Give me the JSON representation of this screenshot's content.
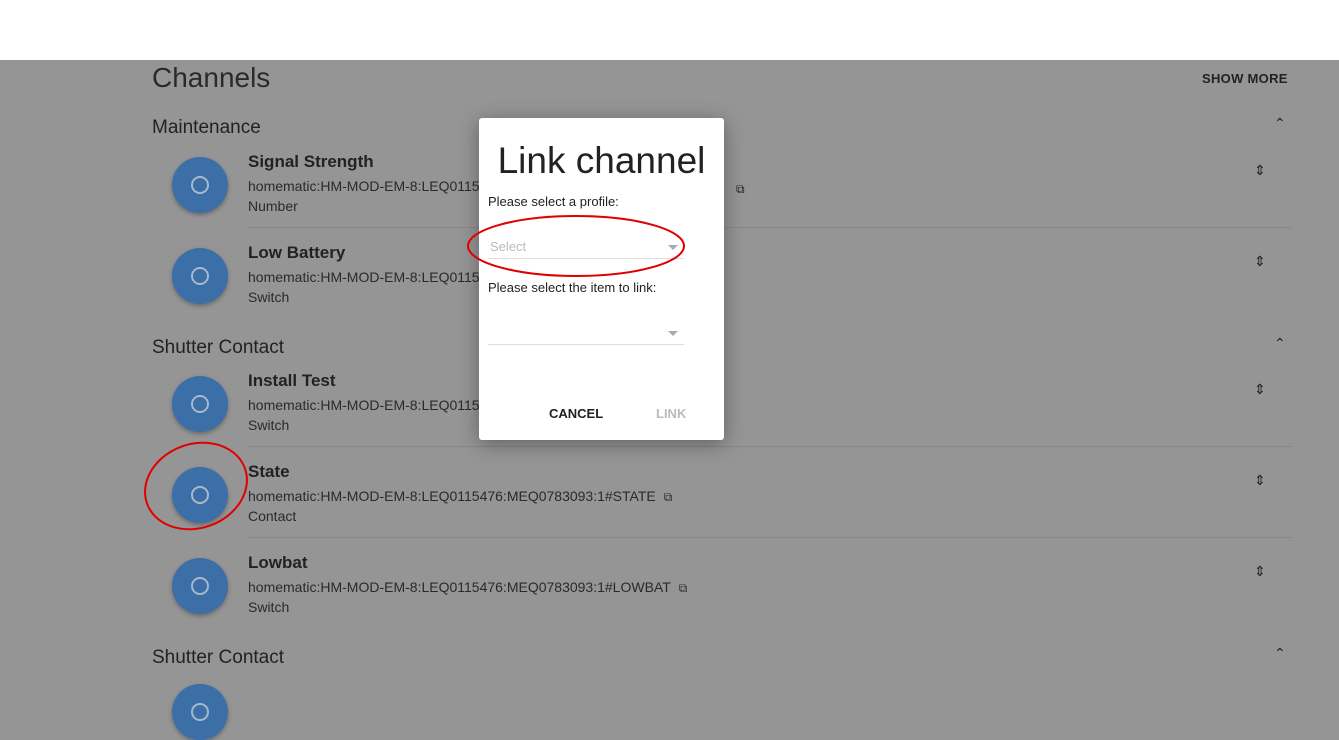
{
  "page": {
    "title": "Channels",
    "show_more": "SHOW MORE"
  },
  "groups": [
    {
      "label": "Maintenance",
      "items": [
        {
          "name": "Signal Strength",
          "uid": "homematic:HM-MOD-EM-8:LEQ01154",
          "type": "Number"
        },
        {
          "name": "Low Battery",
          "uid": "homematic:HM-MOD-EM-8:LEQ01154",
          "type": "Switch"
        }
      ]
    },
    {
      "label": "Shutter Contact",
      "items": [
        {
          "name": "Install Test",
          "uid": "homematic:HM-MOD-EM-8:LEQ01154",
          "type": "Switch"
        },
        {
          "name": "State",
          "uid": "homematic:HM-MOD-EM-8:LEQ0115476:MEQ0783093:1#STATE",
          "type": "Contact"
        },
        {
          "name": "Lowbat",
          "uid": "homematic:HM-MOD-EM-8:LEQ0115476:MEQ0783093:1#LOWBAT",
          "type": "Switch"
        }
      ]
    },
    {
      "label": "Shutter Contact",
      "items": []
    }
  ],
  "dialog": {
    "title": "Link channel",
    "profile_label": "Please select a profile:",
    "profile_placeholder": "Select",
    "item_label": "Please select the item to link:",
    "cancel": "CANCEL",
    "link": "LINK"
  },
  "colors": {
    "accent": "#3c6ea7",
    "annotation": "#e00000"
  }
}
